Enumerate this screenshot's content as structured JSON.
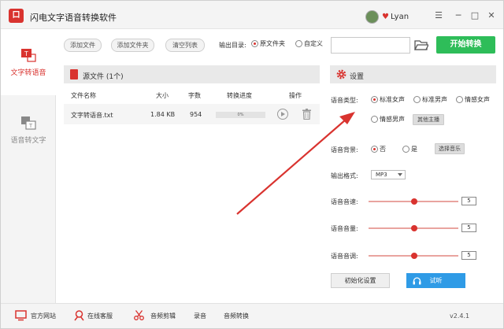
{
  "app": {
    "title": "闪电文字语音转换软件",
    "logo_glyph": "口",
    "user": "Lyan"
  },
  "window": {
    "minimize": "─",
    "restore": "□",
    "close": "✕",
    "menu": "☰"
  },
  "sidebar": {
    "items": [
      {
        "label": "文字转语音",
        "active": true,
        "icon": "text-to-speech-icon"
      },
      {
        "label": "语音转文字",
        "active": false,
        "icon": "speech-to-text-icon"
      }
    ]
  },
  "toolbar": {
    "add_file": "添加文件",
    "add_folder": "添加文件夹",
    "clear_list": "清空列表",
    "output_dir_label": "输出目录:",
    "output_options": [
      "原文件夹",
      "自定义"
    ],
    "output_selected": "原文件夹",
    "path_value": "",
    "start": "开始转换"
  },
  "file_panel": {
    "title": "源文件 (1个)",
    "columns": [
      "文件名称",
      "大小",
      "字数",
      "转换进度",
      "操作"
    ],
    "rows": [
      {
        "name": "文字转语音.txt",
        "size": "1.84 KB",
        "words": "954",
        "progress": "0%"
      }
    ]
  },
  "settings": {
    "title": "设置",
    "voice_type_label": "语音类型:",
    "voice_options": [
      "标准女声",
      "标准男声",
      "情感女声",
      "情感男声"
    ],
    "voice_selected": "标准女声",
    "other_voices": "其他主播",
    "bg_label": "语音背景:",
    "bg_options": [
      "否",
      "是"
    ],
    "bg_selected": "否",
    "choose_music": "选择音乐",
    "format_label": "输出格式:",
    "format_value": "MP3",
    "speed_label": "语音音速:",
    "speed_value": "5",
    "volume_label": "语音音量:",
    "volume_value": "5",
    "pitch_label": "语音音调:",
    "pitch_value": "5",
    "init_button": "初始化设置",
    "listen_button": "试听"
  },
  "footer": {
    "items": [
      "官方网站",
      "在线客服",
      "音频剪辑",
      "录音",
      "音频转换"
    ],
    "version": "v2.4.1"
  },
  "colors": {
    "accent": "#d9332f",
    "start": "#2ebd59",
    "listen": "#2f9be6"
  }
}
